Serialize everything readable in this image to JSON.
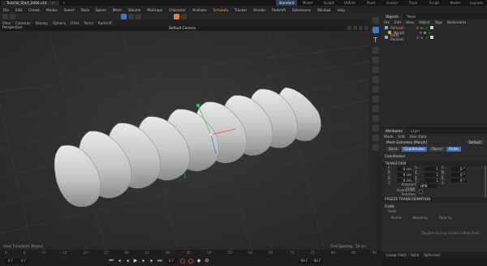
{
  "window": {
    "tab_title": "Tutorial_Start_0006.c4d",
    "layouts": [
      "Standard",
      "Model",
      "Sculpt",
      "UVEdit",
      "Paint",
      "Groom",
      "Track",
      "Script",
      "Nodes",
      "Layouts"
    ],
    "active_layout": "Standard"
  },
  "menubar": {
    "items": [
      "File",
      "Edit",
      "Create",
      "Modes",
      "Select",
      "Tools",
      "Spline",
      "Mesh",
      "Volume",
      "MoGraph",
      "Character",
      "Animate",
      "Simulate",
      "Tracker",
      "Render",
      "Redshift",
      "Extensions",
      "Window",
      "Help"
    ],
    "highlighted": "Simulate"
  },
  "viewport": {
    "menu": [
      "View",
      "Cameras",
      "Display",
      "Options",
      "Filter",
      "Panel",
      "Redshift"
    ],
    "label": "Perspective",
    "camera": "Default Camera",
    "status_left": "View Transform: Project",
    "status_right": "Grid Spacing : 50 cm"
  },
  "timeline": {
    "ticks": [
      "0",
      "5",
      "10",
      "15",
      "20",
      "25",
      "30",
      "35",
      "40",
      "45",
      "50",
      "55",
      "60",
      "65",
      "70",
      "75",
      "80",
      "85",
      "90"
    ],
    "start_frame": "0 F",
    "start_frame2": "0 F",
    "current_frame": "0 F",
    "end_frame": "90 F",
    "end_frame2": "90 F"
  },
  "objects_panel": {
    "tabs": [
      "Objects",
      "Takes"
    ],
    "menu": [
      "File",
      "Edit",
      "View",
      "Object",
      "Tags",
      "Bookmarks"
    ],
    "items": [
      {
        "name": "Remesh",
        "color": "#7ab4e8"
      },
      {
        "name": "Morph",
        "color": "#e6a144"
      },
      {
        "name": "Puffy Remesh",
        "color": "#7ab4e8"
      }
    ]
  },
  "attributes_panel": {
    "tabs": [
      "Attributes",
      "Layer"
    ],
    "menu": [
      "Mode",
      "Edit",
      "User Data"
    ],
    "object_name": "Mesh Extremes [Morph]",
    "default_label": "Default",
    "prop_tabs": [
      "Basic",
      "Coordinates",
      "Object",
      "Fields"
    ],
    "selected_tab": "Coordinates",
    "section_title": "Coordinates",
    "transform_label": "TRANSFORM",
    "rows": [
      {
        "p": "P . X",
        "pv": "0 cm",
        "s": "S . X",
        "sv": "1",
        "r": "R . H",
        "rv": "0 °"
      },
      {
        "p": "P . Y",
        "pv": "0 cm",
        "s": "S . Y",
        "sv": "1",
        "r": "R . P",
        "rv": "0 °"
      },
      {
        "p": "P . Z",
        "pv": "0 cm",
        "s": "S . Z",
        "sv": "1",
        "r": "R . B",
        "rv": "0 °"
      }
    ],
    "rotation_order_label": "Rotation Order",
    "rotation_order_value": "HPB",
    "quaternion_label": "Quaternion Rotation",
    "freeze_label": "FREEZE TRANSFORMATION",
    "fields_section": "Fields",
    "fields_sub": "Field",
    "fields_columns": [
      "Name",
      "Blending",
      "Opacity"
    ],
    "fields_empty": "Double-click to create a New Field",
    "footer": [
      "Linear Field",
      "Solid",
      "Spherical"
    ]
  }
}
